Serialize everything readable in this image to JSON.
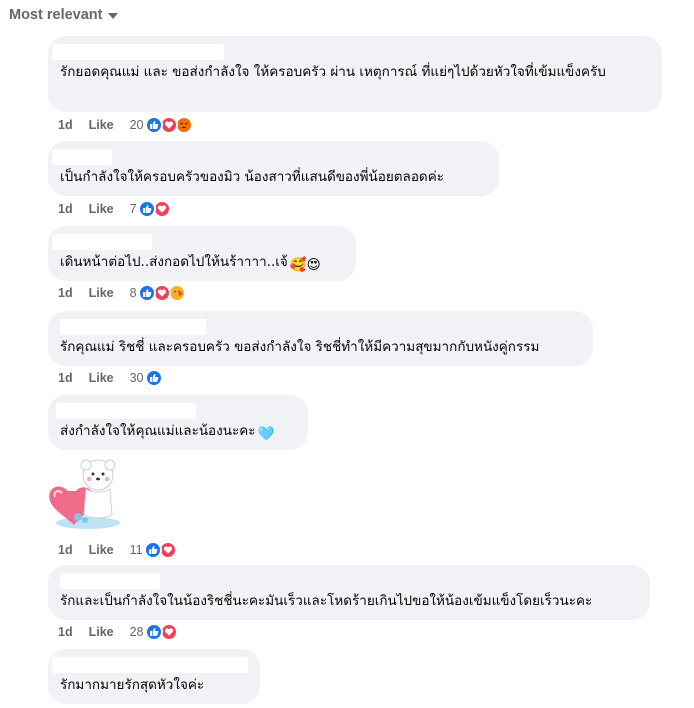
{
  "sort": {
    "label": "Most relevant"
  },
  "comments": [
    {
      "text": "รักยอดคุณแม่ และ ขอส่งกำลังใจ ให้ครอบครัว ผ่าน เหตุการณ์ ที่แย่ๆไปด้วยหัวใจที่เข้มแข็งครับ",
      "age": "1d",
      "like_label": "Like",
      "reaction_count": "20",
      "reactions": [
        "like",
        "love",
        "angry"
      ]
    },
    {
      "text": "เป็นกำลังใจให้ครอบครัวของมิว น้องสาวที่แสนดีของพี่น้อยตลอดค่ะ",
      "age": "1d",
      "like_label": "Like",
      "reaction_count": "7",
      "reactions": [
        "like",
        "love"
      ]
    },
    {
      "text": "เดินหน้าต่อไป..ส่งกอดไปให้นร้าาาา..เจ้",
      "emoji": "🥰😍",
      "age": "1d",
      "like_label": "Like",
      "reaction_count": "8",
      "reactions": [
        "like",
        "love",
        "care"
      ]
    },
    {
      "text": "รักคุณแม่ ริชชี่ และครอบครัว ขอส่งกำลังใจ ริชชี่ทำให้มีความสุขมากกับหนังคู่กรรม",
      "age": "1d",
      "like_label": "Like",
      "reaction_count": "30",
      "reactions": [
        "like"
      ]
    },
    {
      "text": "ส่งกำลังใจให้คุณแม่และน้องนะคะ",
      "emoji": "🩵",
      "age": "1d",
      "like_label": "Like",
      "reaction_count": "11",
      "reactions": [
        "like",
        "love"
      ],
      "sticker": "bear-hugging-heart-sticker"
    },
    {
      "text": "รักและเป็นกำลังใจในน้องริชชี่นะคะมันเร็วและโหดร้ายเกินไปขอให้น้องเข้มแข็งโดยเร็วนะคะ",
      "age": "1d",
      "like_label": "Like",
      "reaction_count": "28",
      "reactions": [
        "like",
        "love"
      ]
    },
    {
      "text": "รักมากมายรักสุดหัวใจค่ะ"
    }
  ],
  "colors": {
    "bubble": "#f0f2f5",
    "secondary_text": "#65676b",
    "like_blue": "#1b74e4",
    "love_red": "#f33e58",
    "angry_orange": "#e9710f"
  }
}
